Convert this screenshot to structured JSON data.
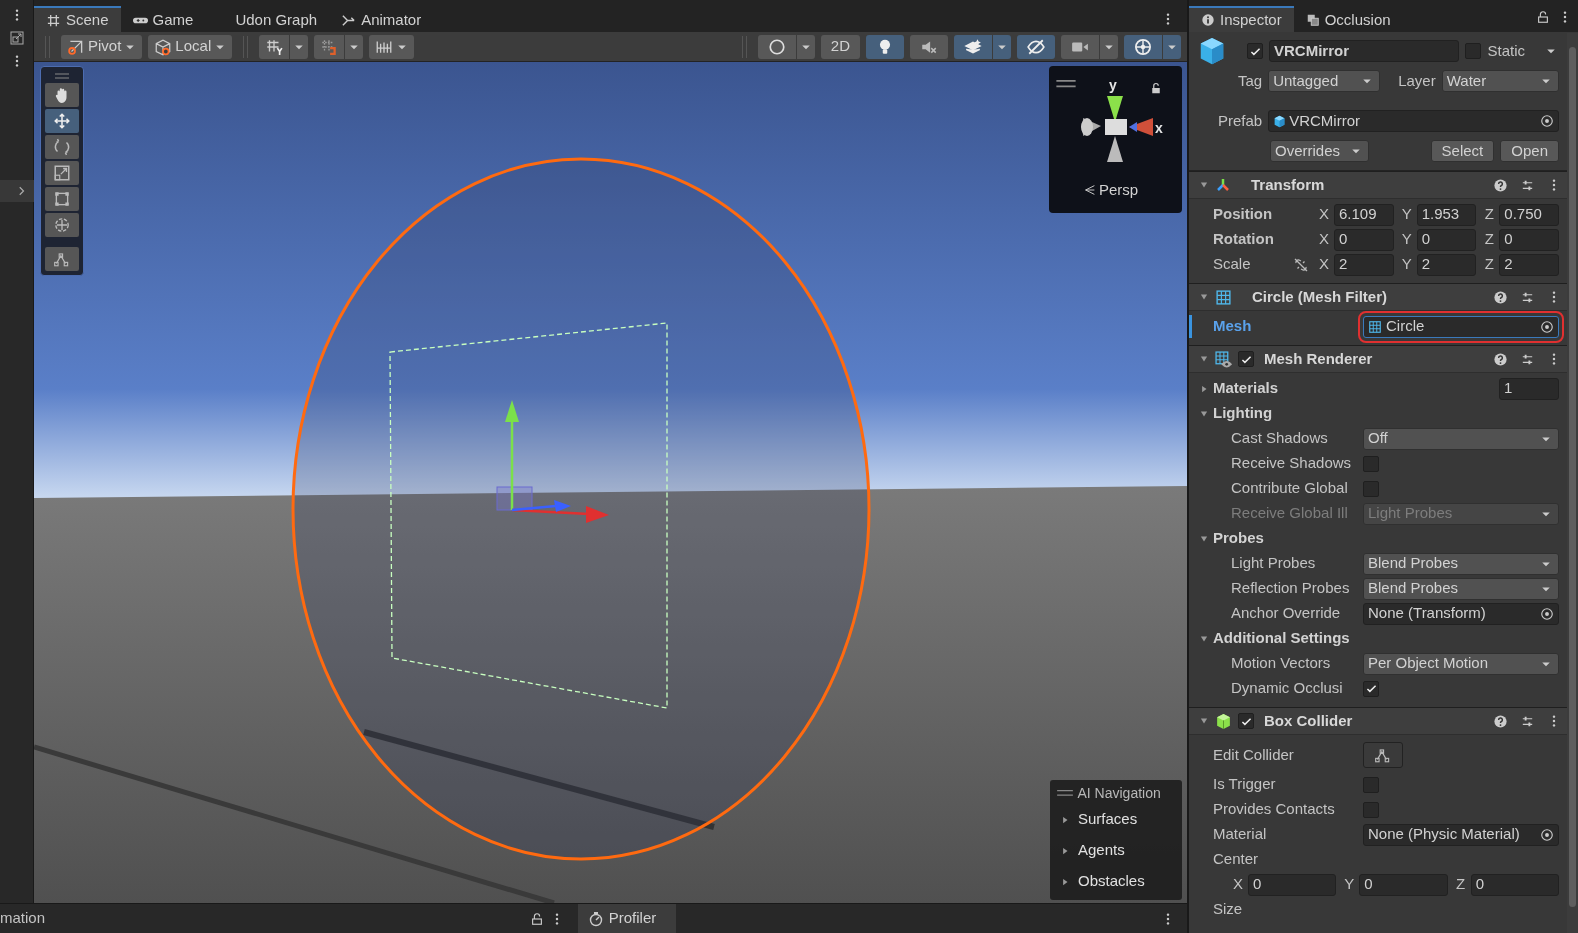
{
  "left_strip": {
    "status_text": "mation"
  },
  "scene_window": {
    "tabs": [
      {
        "label": "Scene",
        "selected": true
      },
      {
        "label": "Game",
        "selected": false
      },
      {
        "label": "Udon Graph",
        "selected": false
      },
      {
        "label": "Animator",
        "selected": false
      }
    ],
    "toolbar_left": [
      {
        "kind": "dropdown",
        "label": "Pivot"
      },
      {
        "kind": "dropdown",
        "label": "Local"
      },
      {
        "kind": "split"
      },
      {
        "kind": "split"
      },
      {
        "kind": "dropdown"
      }
    ],
    "toolbar_right": [
      {
        "active": false,
        "dropdown": true
      },
      {
        "label": "2D",
        "active": false,
        "dropdown": false
      },
      {
        "active": true,
        "dropdown": false
      },
      {
        "active": false,
        "dropdown": false
      },
      {
        "active": true,
        "dropdown": true
      },
      {
        "active": true,
        "dropdown": false
      },
      {
        "active": false,
        "dropdown": true
      },
      {
        "active": true,
        "dropdown": true
      }
    ],
    "tools": [
      {
        "selected": false
      },
      {
        "selected": true
      },
      {
        "selected": false
      },
      {
        "selected": false
      },
      {
        "selected": false
      },
      {
        "selected": false
      }
    ],
    "custom_tools": [
      {
        "selected": false
      }
    ],
    "orientation": {
      "y_label": "y",
      "x_label": "x",
      "projection": "Persp"
    },
    "ai_navigation": {
      "title": "AI Navigation",
      "items": [
        {
          "label": "Surfaces",
          "expanded": false
        },
        {
          "label": "Agents",
          "expanded": false
        },
        {
          "label": "Obstacles",
          "expanded": false
        }
      ]
    }
  },
  "bottom_bar": {
    "tab": "Profiler"
  },
  "inspector": {
    "tabs": [
      {
        "label": "Inspector",
        "selected": true
      },
      {
        "label": "Occlusion",
        "selected": false
      }
    ],
    "object": {
      "active": true,
      "name": "VRCMirror",
      "static": false,
      "static_label": "Static",
      "tag_label": "Tag",
      "tag": "Untagged",
      "layer_label": "Layer",
      "layer": "Water",
      "prefab_label": "Prefab",
      "prefab": "VRCMirror",
      "overrides": "Overrides",
      "buttons": [
        "Select",
        "Open"
      ]
    },
    "components": [
      {
        "title": "Transform",
        "expanded": true,
        "rows": [
          {
            "kind": "vector3",
            "label": "Position",
            "overridden": true,
            "fields": [
              {
                "axis": "X",
                "value": "6.109"
              },
              {
                "axis": "Y",
                "value": "1.953"
              },
              {
                "axis": "Z",
                "value": "0.750"
              }
            ]
          },
          {
            "kind": "vector3",
            "label": "Rotation",
            "overridden": true,
            "fields": [
              {
                "axis": "X",
                "value": "0"
              },
              {
                "axis": "Y",
                "value": "0"
              },
              {
                "axis": "Z",
                "value": "0"
              }
            ]
          },
          {
            "kind": "vector3",
            "label": "Scale",
            "overridden": false,
            "constrained": false,
            "fields": [
              {
                "axis": "X",
                "value": "2"
              },
              {
                "axis": "Y",
                "value": "2"
              },
              {
                "axis": "Z",
                "value": "2"
              }
            ]
          }
        ]
      },
      {
        "title": "Circle (Mesh Filter)",
        "expanded": true,
        "rows": [
          {
            "kind": "object",
            "label": "Mesh",
            "value": "Circle",
            "selected": true,
            "highlighted": true
          }
        ]
      },
      {
        "title": "Mesh Renderer",
        "enabled": true,
        "expanded": true,
        "rows": [
          {
            "kind": "foldout",
            "label": "Materials",
            "expanded": false,
            "value": "1"
          },
          {
            "kind": "foldout",
            "label": "Lighting",
            "expanded": true,
            "children": [
              {
                "kind": "dropdown",
                "label": "Cast Shadows",
                "value": "Off",
                "disabled": false
              },
              {
                "kind": "checkbox",
                "label": "Receive Shadows",
                "checked": false
              },
              {
                "kind": "checkbox",
                "label": "Contribute Global",
                "checked": false
              },
              {
                "kind": "dropdown",
                "label": "Receive Global Ill",
                "value": "Light Probes",
                "disabled": true
              }
            ]
          },
          {
            "kind": "foldout",
            "label": "Probes",
            "expanded": true,
            "children": [
              {
                "kind": "dropdown",
                "label": "Light Probes",
                "value": "Blend Probes",
                "disabled": false
              },
              {
                "kind": "dropdown",
                "label": "Reflection Probes",
                "value": "Blend Probes",
                "disabled": false
              },
              {
                "kind": "object",
                "label": "Anchor Override",
                "value": "None (Transform)",
                "selected": false,
                "highlighted": false
              }
            ]
          },
          {
            "kind": "foldout",
            "label": "Additional Settings",
            "expanded": true,
            "children": [
              {
                "kind": "dropdown",
                "label": "Motion Vectors",
                "value": "Per Object Motion",
                "disabled": false
              },
              {
                "kind": "checkbox",
                "label": "Dynamic Occlusi",
                "checked": true
              }
            ]
          }
        ]
      },
      {
        "title": "Box Collider",
        "enabled": true,
        "expanded": true,
        "rows": [
          {
            "kind": "button",
            "label": "Edit Collider"
          },
          {
            "kind": "checkbox",
            "label": "Is Trigger",
            "checked": false
          },
          {
            "kind": "checkbox",
            "label": "Provides Contacts",
            "checked": false
          },
          {
            "kind": "object",
            "label": "Material",
            "value": "None (Physic Material)",
            "selected": false,
            "highlighted": false
          },
          {
            "kind": "label",
            "label": "Center"
          },
          {
            "kind": "vector3",
            "fields": [
              {
                "axis": "X",
                "value": "0"
              },
              {
                "axis": "Y",
                "value": "0"
              },
              {
                "axis": "Z",
                "value": "0"
              }
            ]
          },
          {
            "kind": "label",
            "label": "Size"
          }
        ]
      }
    ]
  }
}
